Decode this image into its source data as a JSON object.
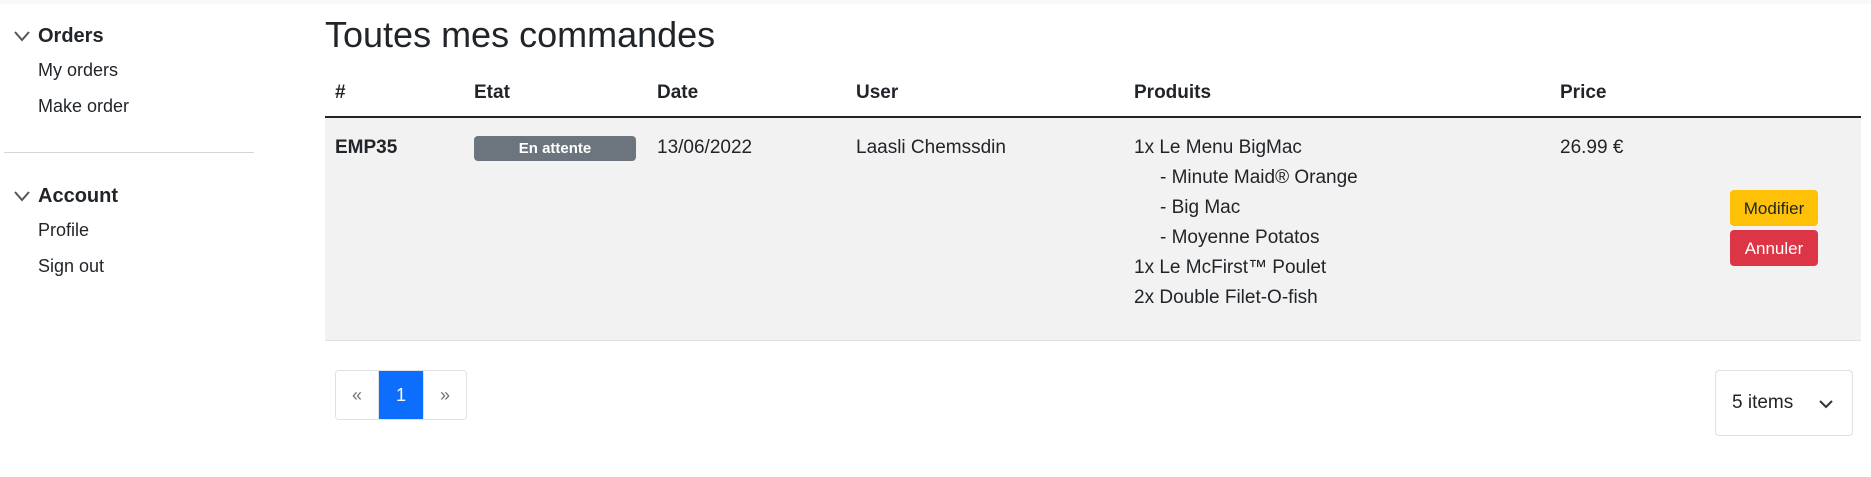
{
  "sidebar": {
    "orders": {
      "title": "Orders",
      "items": [
        {
          "label": "My orders"
        },
        {
          "label": "Make order"
        }
      ]
    },
    "account": {
      "title": "Account",
      "items": [
        {
          "label": "Profile"
        },
        {
          "label": "Sign out"
        }
      ]
    }
  },
  "main": {
    "title": "Toutes mes commandes",
    "table": {
      "headers": [
        "#",
        "Etat",
        "Date",
        "User",
        "Produits",
        "Price"
      ],
      "rows": [
        {
          "id": "EMP35",
          "status": "En attente",
          "date": "13/06/2022",
          "user": "Laasli Chemssdin",
          "products": [
            "1x Le Menu BigMac",
            "- Minute Maid® Orange",
            "- Big Mac",
            "- Moyenne Potatos",
            "1x Le McFirst™ Poulet",
            "2x Double Filet-O-fish"
          ],
          "price": "26.99 €",
          "edit_label": "Modifier",
          "cancel_label": "Annuler"
        }
      ]
    },
    "pagination": {
      "prev": "«",
      "current": "1",
      "next": "»"
    },
    "page_size": {
      "selected": "5 items"
    }
  },
  "colors": {
    "badge": "#6c757d",
    "edit": "#ffc107",
    "cancel": "#dc3545",
    "active_page": "#0d6efd",
    "row_bg": "#f2f2f2"
  }
}
